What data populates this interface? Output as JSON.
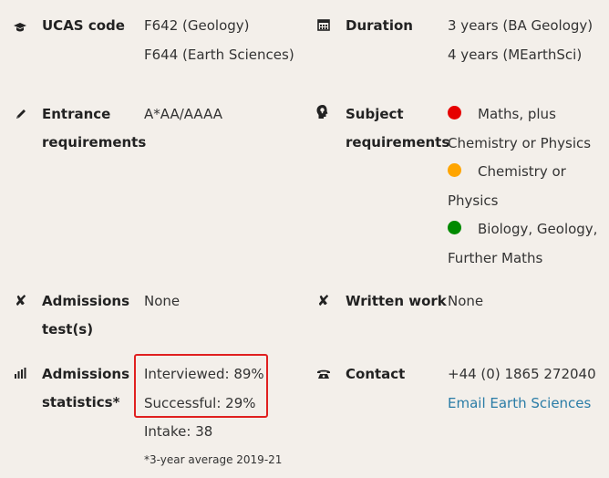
{
  "ucas": {
    "label": "UCAS code",
    "values": [
      "F642 (Geology)",
      "F644 (Earth Sciences)"
    ]
  },
  "duration": {
    "label": "Duration",
    "values": [
      "3 years (BA Geology)",
      "4 years (MEarthSci)"
    ]
  },
  "entrance": {
    "label_line1": "Entrance",
    "label_line2": "requirements",
    "value": "A*AA/AAAA"
  },
  "subject": {
    "label_line1": "Subject",
    "label_line2": "requirements",
    "items": [
      {
        "color": "#e60000",
        "text_line1": "Maths, plus",
        "text_line2": "Chemistry or Physics"
      },
      {
        "color": "#ffa500",
        "text_line1": "Chemistry or",
        "text_line2": "Physics"
      },
      {
        "color": "#008a00",
        "text_line1": "Biology, Geology,",
        "text_line2": "Further Maths"
      }
    ]
  },
  "admissions_test": {
    "label_line1": "Admissions",
    "label_line2": "test(s)",
    "value": "None"
  },
  "written_work": {
    "label": "Written work",
    "value": "None"
  },
  "admissions_stats": {
    "label_line1": "Admissions",
    "label_line2": "statistics*",
    "interviewed": "Interviewed: 89%",
    "successful": "Successful: 29%",
    "intake": "Intake: 38",
    "footnote": "*3-year average 2019-21"
  },
  "contact": {
    "label": "Contact",
    "phone": "+44 (0) 1865 272040",
    "email_link": "Email Earth Sciences"
  },
  "colors": {
    "link": "#2a7ca6",
    "highlight_box": "#e02020",
    "background": "#f3efea"
  }
}
